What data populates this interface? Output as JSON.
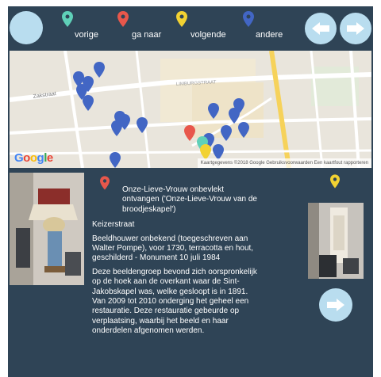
{
  "legend": [
    {
      "label": "vorige",
      "color": "#5fd0b8",
      "icon": "map-pin-icon"
    },
    {
      "label": "ga naar",
      "color": "#e8574b",
      "icon": "map-pin-icon"
    },
    {
      "label": "volgende",
      "color": "#f2d232",
      "icon": "map-pin-icon"
    },
    {
      "label": "andere",
      "color": "#4266c4",
      "icon": "map-pin-icon"
    }
  ],
  "nav": {
    "home": "home-icon",
    "previous": "arrow-left-icon",
    "next": "arrow-right-icon"
  },
  "map": {
    "provider": "Google",
    "attribution": "Kaartgegevens ©2018 Google   Gebruiksvoorwaarden   Een kaartfout rapporteren",
    "street_labels": [
      "Zakstraat",
      "LIMBURGSTRAAT"
    ]
  },
  "info": {
    "title": "Onze-Lieve-Vrouw onbevlekt ontvangen ('Onze-Lieve-Vrouw van de broodjeskapel')",
    "street": "Keizerstraat",
    "details": "Beeldhouwer onbekend (toegeschreven aan Walter Pompe), voor 1730, terracotta en hout, geschilderd - Monument 10 juli 1984",
    "description": "Deze beeldengroep bevond zich oorspronkelijk op de hoek aan de overkant waar de Sint-Jakobskapel was, welke gesloopt is in 1891. Van 2009 tot 2010 onderging het geheel een restauratie. Deze restauratie gebeurde op verplaatsing, waarbij het beeld en haar onderdelen afgenomen werden."
  },
  "colors": {
    "background": "#2f4456",
    "button": "#b9ddef"
  }
}
